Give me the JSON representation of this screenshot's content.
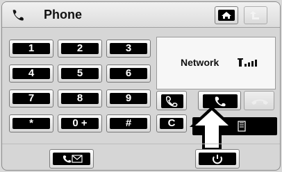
{
  "header": {
    "title": "Phone",
    "icons": [
      "phone-handset-icon",
      "home-icon",
      "up-arrow-icon"
    ]
  },
  "keypad": {
    "keys": [
      "1",
      "2",
      "3",
      "4",
      "5",
      "6",
      "7",
      "8",
      "9",
      "*",
      "0 +",
      "#"
    ]
  },
  "network": {
    "label": "Network",
    "icon": "signal-strength-icon"
  },
  "controls": {
    "clear_label": "C",
    "call_icons": [
      "call-outline-icon",
      "call-answer-icon",
      "hangup-icon"
    ],
    "bottom_icons": [
      "voicemail-icon",
      "power-icon"
    ]
  },
  "colors": {
    "accent": "#000000",
    "background": "#d9d9d9",
    "panel": "#f7f7f7"
  }
}
